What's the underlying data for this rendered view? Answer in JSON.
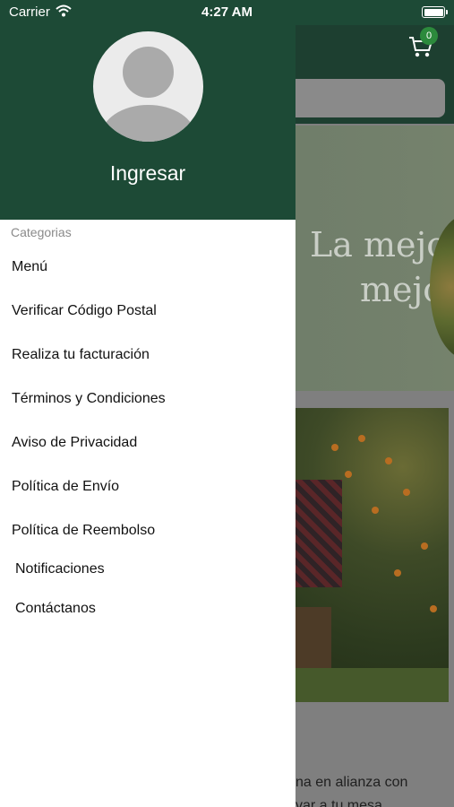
{
  "status_bar": {
    "carrier": "Carrier",
    "time": "4:27 AM"
  },
  "background_page": {
    "cart_count": "0",
    "hero_line1": "La mejor",
    "hero_line2": "mejor",
    "text_line1": "na en alianza con",
    "text_line2": "var a tu mesa"
  },
  "drawer": {
    "login_label": "Ingresar",
    "section_title": "Categorias",
    "items": [
      {
        "label": "Menú"
      },
      {
        "label": "Verificar Código Postal"
      },
      {
        "label": "Realiza tu facturación"
      },
      {
        "label": "Términos y Condiciones"
      },
      {
        "label": "Aviso de Privacidad"
      },
      {
        "label": "Política de Envío"
      },
      {
        "label": "Política de Reembolso"
      },
      {
        "label": "Notificaciones"
      },
      {
        "label": "Contáctanos"
      }
    ]
  },
  "colors": {
    "header_green": "#1d4a36",
    "badge_green": "#2c8a3c"
  }
}
